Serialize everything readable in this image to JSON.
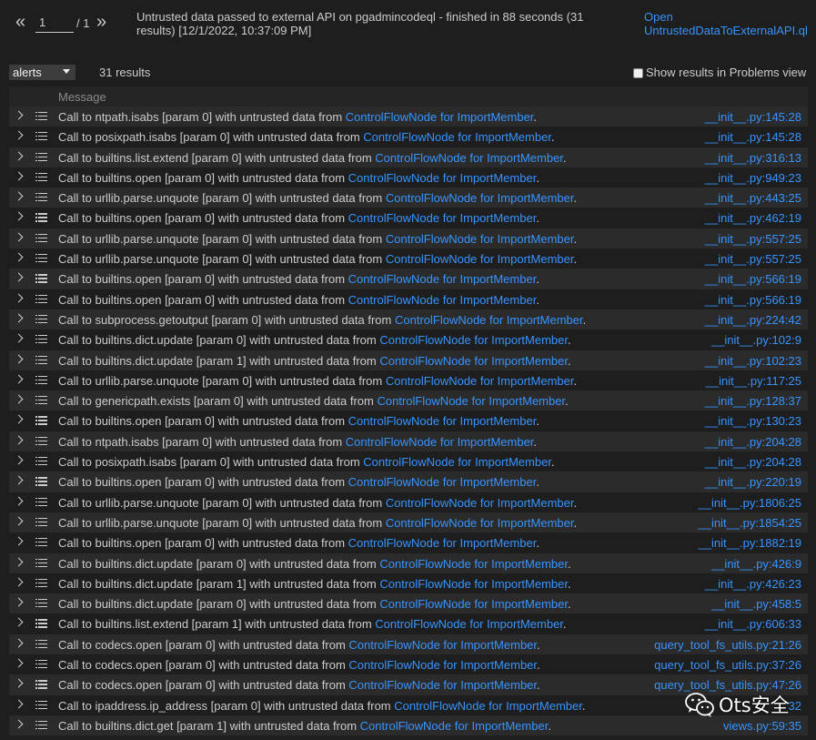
{
  "pager": {
    "prev": "«",
    "next": "»",
    "current_page": "1",
    "total": "/ 1"
  },
  "run_info": "Untrusted data passed to external API on pgadmincodeql - finished in 88 seconds (31 results) [12/1/2022, 10:37:09 PM]",
  "open_link": "Open UntrustedDataToExternalAPI.ql",
  "result_set": {
    "selected": "alerts",
    "count_text": "31 results"
  },
  "problems_checkbox": {
    "label": "Show results in Problems view",
    "checked": false
  },
  "table": {
    "header": "Message",
    "rows": [
      {
        "prefix": "Call to ntpath.isabs [param 0] with untrusted data from ",
        "link": "ControlFlowNode for ImportMember",
        "suffix": ".",
        "loc": "__init__.py:145:28"
      },
      {
        "prefix": "Call to posixpath.isabs [param 0] with untrusted data from ",
        "link": "ControlFlowNode for ImportMember",
        "suffix": ".",
        "loc": "__init__.py:145:28"
      },
      {
        "prefix": "Call to builtins.list.extend [param 0] with untrusted data from ",
        "link": "ControlFlowNode for ImportMember",
        "suffix": ".",
        "loc": "__init__.py:316:13"
      },
      {
        "prefix": "Call to builtins.open [param 0] with untrusted data from ",
        "link": "ControlFlowNode for ImportMember",
        "suffix": ".",
        "loc": "__init__.py:949:23"
      },
      {
        "prefix": "Call to urllib.parse.unquote [param 0] with untrusted data from ",
        "link": "ControlFlowNode for ImportMember",
        "suffix": ".",
        "loc": "__init__.py:443:25"
      },
      {
        "prefix": "Call to builtins.open [param 0] with untrusted data from ",
        "link": "ControlFlowNode for ImportMember",
        "suffix": ".",
        "loc": "__init__.py:462:19"
      },
      {
        "prefix": "Call to urllib.parse.unquote [param 0] with untrusted data from ",
        "link": "ControlFlowNode for ImportMember",
        "suffix": ".",
        "loc": "__init__.py:557:25"
      },
      {
        "prefix": "Call to urllib.parse.unquote [param 0] with untrusted data from ",
        "link": "ControlFlowNode for ImportMember",
        "suffix": ".",
        "loc": "__init__.py:557:25"
      },
      {
        "prefix": "Call to builtins.open [param 0] with untrusted data from ",
        "link": "ControlFlowNode for ImportMember",
        "suffix": ".",
        "loc": "__init__.py:566:19"
      },
      {
        "prefix": "Call to builtins.open [param 0] with untrusted data from ",
        "link": "ControlFlowNode for ImportMember",
        "suffix": ".",
        "loc": "__init__.py:566:19"
      },
      {
        "prefix": "Call to subprocess.getoutput [param 0] with untrusted data from ",
        "link": "ControlFlowNode for ImportMember",
        "suffix": ".",
        "loc": "__init__.py:224:42"
      },
      {
        "prefix": "Call to builtins.dict.update [param 0] with untrusted data from ",
        "link": "ControlFlowNode for ImportMember",
        "suffix": ".",
        "loc": "__init__.py:102:9"
      },
      {
        "prefix": "Call to builtins.dict.update [param 1] with untrusted data from ",
        "link": "ControlFlowNode for ImportMember",
        "suffix": ".",
        "loc": "__init__.py:102:23"
      },
      {
        "prefix": "Call to urllib.parse.unquote [param 0] with untrusted data from ",
        "link": "ControlFlowNode for ImportMember",
        "suffix": ".",
        "loc": "__init__.py:117:25"
      },
      {
        "prefix": "Call to genericpath.exists [param 0] with untrusted data from ",
        "link": "ControlFlowNode for ImportMember",
        "suffix": ".",
        "loc": "__init__.py:128:37"
      },
      {
        "prefix": "Call to builtins.open [param 0] with untrusted data from ",
        "link": "ControlFlowNode for ImportMember",
        "suffix": ".",
        "loc": "__init__.py:130:23"
      },
      {
        "prefix": "Call to ntpath.isabs [param 0] with untrusted data from ",
        "link": "ControlFlowNode for ImportMember",
        "suffix": ".",
        "loc": "__init__.py:204:28"
      },
      {
        "prefix": "Call to posixpath.isabs [param 0] with untrusted data from ",
        "link": "ControlFlowNode for ImportMember",
        "suffix": ".",
        "loc": "__init__.py:204:28"
      },
      {
        "prefix": "Call to builtins.open [param 0] with untrusted data from ",
        "link": "ControlFlowNode for ImportMember",
        "suffix": ".",
        "loc": "__init__.py:220:19"
      },
      {
        "prefix": "Call to urllib.parse.unquote [param 0] with untrusted data from ",
        "link": "ControlFlowNode for ImportMember",
        "suffix": ".",
        "loc": "__init__.py:1806:25"
      },
      {
        "prefix": "Call to urllib.parse.unquote [param 0] with untrusted data from ",
        "link": "ControlFlowNode for ImportMember",
        "suffix": ".",
        "loc": "__init__.py:1854:25"
      },
      {
        "prefix": "Call to builtins.open [param 0] with untrusted data from ",
        "link": "ControlFlowNode for ImportMember",
        "suffix": ".",
        "loc": "__init__.py:1882:19"
      },
      {
        "prefix": "Call to builtins.dict.update [param 0] with untrusted data from ",
        "link": "ControlFlowNode for ImportMember",
        "suffix": ".",
        "loc": "__init__.py:426:9"
      },
      {
        "prefix": "Call to builtins.dict.update [param 1] with untrusted data from ",
        "link": "ControlFlowNode for ImportMember",
        "suffix": ".",
        "loc": "__init__.py:426:23"
      },
      {
        "prefix": "Call to builtins.dict.update [param 0] with untrusted data from ",
        "link": "ControlFlowNode for ImportMember",
        "suffix": ".",
        "loc": "__init__.py:458:5"
      },
      {
        "prefix": "Call to builtins.list.extend [param 1] with untrusted data from ",
        "link": "ControlFlowNode for ImportMember",
        "suffix": ".",
        "loc": "__init__.py:606:33"
      },
      {
        "prefix": "Call to codecs.open [param 0] with untrusted data from ",
        "link": "ControlFlowNode for ImportMember",
        "suffix": ".",
        "loc": "query_tool_fs_utils.py:21:26"
      },
      {
        "prefix": "Call to codecs.open [param 0] with untrusted data from ",
        "link": "ControlFlowNode for ImportMember",
        "suffix": ".",
        "loc": "query_tool_fs_utils.py:37:26"
      },
      {
        "prefix": "Call to codecs.open [param 0] with untrusted data from ",
        "link": "ControlFlowNode for ImportMember",
        "suffix": ".",
        "loc": "query_tool_fs_utils.py:47:26"
      },
      {
        "prefix": "Call to ipaddress.ip_address [param 0] with untrusted data from ",
        "link": "ControlFlowNode for ImportMember",
        "suffix": ".",
        "loc": "32"
      },
      {
        "prefix": "Call to builtins.dict.get [param 1] with untrusted data from ",
        "link": "ControlFlowNode for ImportMember",
        "suffix": ".",
        "loc": "views.py:59:35"
      }
    ]
  },
  "watermark": {
    "icon": "wechat-icon",
    "text": "Ots安全"
  },
  "colors": {
    "background": "#1e1e1e",
    "row_alt": "#2b2b2b",
    "link": "#3794ff",
    "text": "#cccccc"
  }
}
